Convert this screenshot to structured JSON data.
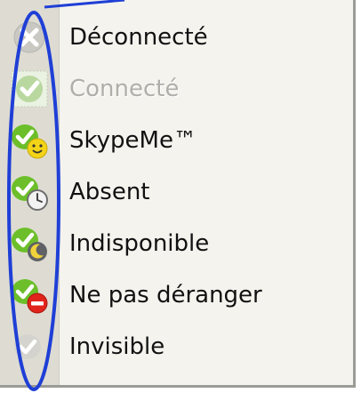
{
  "menu": {
    "items": [
      {
        "label": "Déconnecté",
        "icon": "offline-x-icon",
        "disabled": false
      },
      {
        "label": "Connecté",
        "icon": "online-check-icon",
        "disabled": true
      },
      {
        "label": "SkypeMe™",
        "icon": "skypeme-smiley-icon",
        "disabled": false
      },
      {
        "label": "Absent",
        "icon": "away-clock-icon",
        "disabled": false
      },
      {
        "label": "Indisponible",
        "icon": "not-available-moon-icon",
        "disabled": false
      },
      {
        "label": "Ne pas déranger",
        "icon": "do-not-disturb-icon",
        "disabled": false
      },
      {
        "label": "Invisible",
        "icon": "invisible-check-icon",
        "disabled": false
      }
    ]
  },
  "colors": {
    "annotation_blue": "#1f3fd6",
    "skype_green": "#6cbf2a"
  }
}
